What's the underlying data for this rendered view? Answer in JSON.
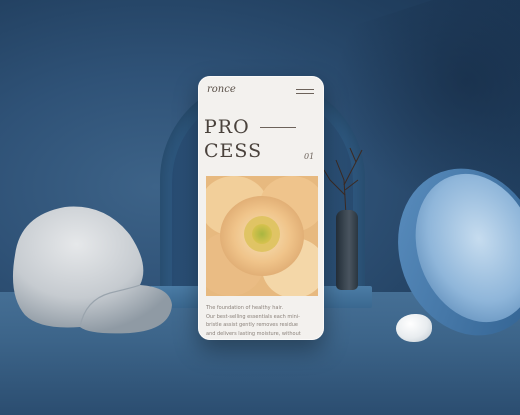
{
  "phone": {
    "brand": "ronce",
    "heading_line1": "PRO",
    "heading_line2": "CESS",
    "page_number": "01",
    "caption_lines": [
      "The foundation of healthy hair.",
      "Our best-selling essentials each mini-",
      "bristle assist gently removes residue",
      "and delivers lasting moisture, without"
    ]
  },
  "colors": {
    "background": "#2c4c6e",
    "phone_screen": "#f3f1ee",
    "text_dark": "#4a423c"
  },
  "icons": {
    "menu": "hamburger-menu-icon"
  }
}
